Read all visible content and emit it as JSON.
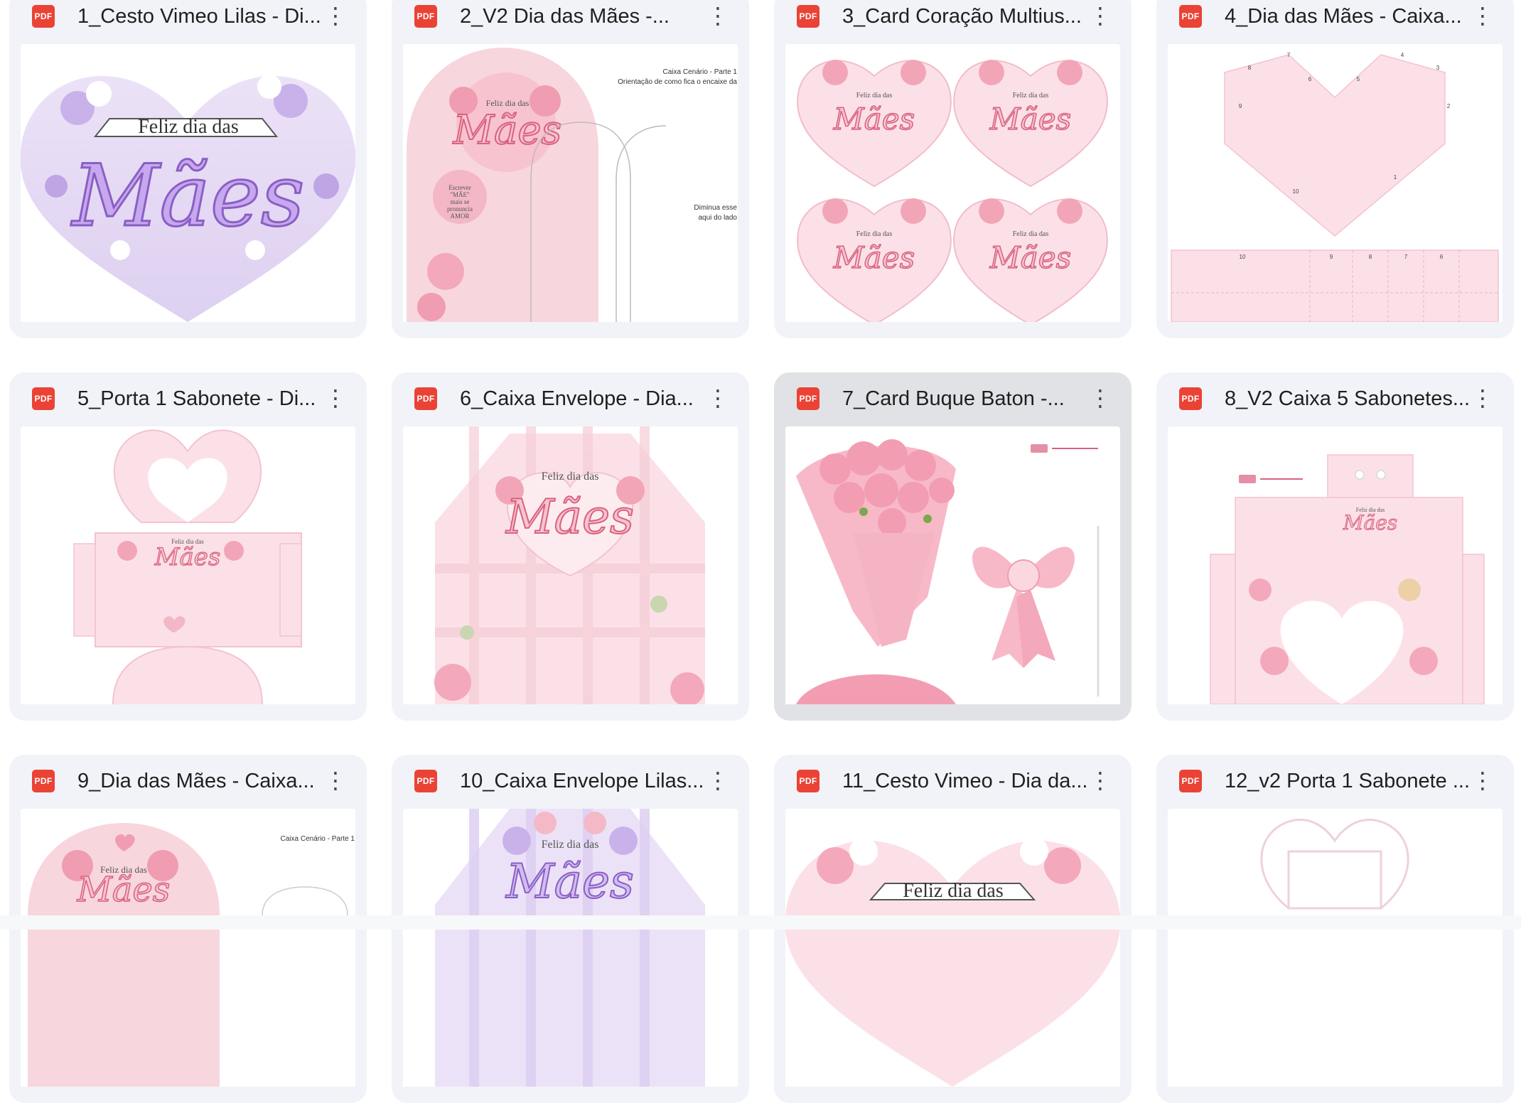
{
  "file_type_label": "PDF",
  "more_icon": "⋮",
  "files": [
    {
      "name": "1_Cesto Vimeo Lilas - Di...",
      "thumb_text": [
        "Feliz dia das",
        "Mães"
      ]
    },
    {
      "name": "2_V2 Dia das Mães -...",
      "thumb_text": [
        "Feliz dia das",
        "Mães",
        "Caixa Cenário - Parte 1",
        "Orientação de como fica o encaixe da",
        "Diminua esse",
        "aqui do lado",
        "Escrever",
        "\"MÃE\"",
        "mais se",
        "pronuncia",
        "AMOR"
      ]
    },
    {
      "name": "3_Card Coração Multius...",
      "thumb_text": [
        "Feliz dia das",
        "Mães"
      ]
    },
    {
      "name": "4_Dia das Mães - Caixa...",
      "thumb_text": [
        "7",
        "8",
        "6",
        "5",
        "4",
        "3",
        "9",
        "2",
        "10",
        "1",
        "10",
        "9",
        "8",
        "7",
        "6"
      ]
    },
    {
      "name": "5_Porta 1 Sabonete - Di...",
      "thumb_text": [
        "Feliz dia das",
        "Mães"
      ]
    },
    {
      "name": "6_Caixa Envelope - Dia...",
      "thumb_text": [
        "Feliz dia das",
        "Mães"
      ]
    },
    {
      "name": "7_Card Buque Baton -...",
      "thumb_text": []
    },
    {
      "name": "8_V2 Caixa 5 Sabonetes...",
      "thumb_text": [
        "Feliz dia das",
        "Mães"
      ]
    },
    {
      "name": "9_Dia das Mães - Caixa...",
      "thumb_text": [
        "Feliz dia das",
        "Mães",
        "Caixa Cenário - Parte 1"
      ]
    },
    {
      "name": "10_Caixa Envelope Lilas...",
      "thumb_text": [
        "Feliz dia das",
        "Mães"
      ]
    },
    {
      "name": "11_Cesto Vimeo - Dia da...",
      "thumb_text": [
        "Feliz dia das"
      ]
    },
    {
      "name": "12_v2 Porta 1 Sabonete ...",
      "thumb_text": []
    }
  ],
  "colors": {
    "card_bg": "#f1f3f8",
    "card_selected_bg": "#e1e2e5",
    "pdf_red": "#ea4335",
    "pink": "#f6c9d3",
    "pink_dark": "#e58fa4",
    "lilac": "#d8c6ef",
    "lilac_dark": "#a77fd6"
  },
  "selected_index": 6
}
